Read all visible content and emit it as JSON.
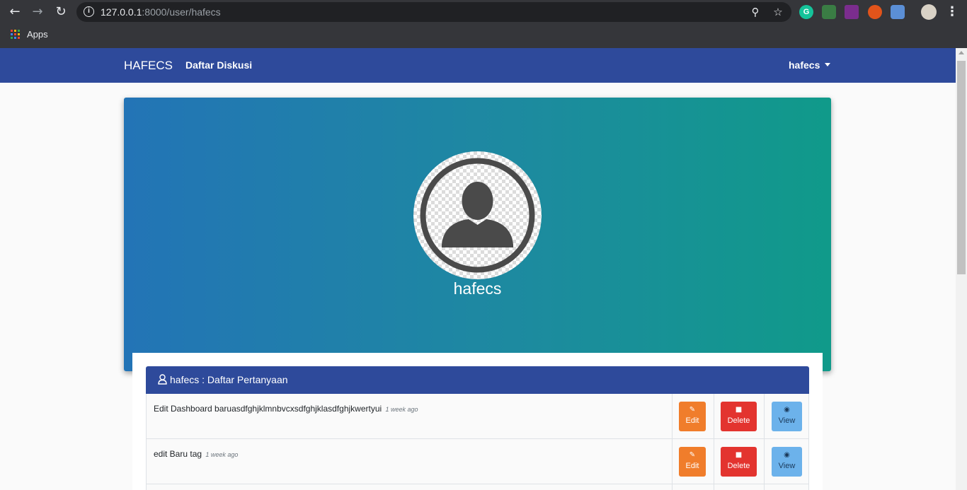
{
  "browser": {
    "url_host": "127.0.0.1",
    "url_rest": ":8000/user/hafecs",
    "bookmark_apps": "Apps",
    "extension_g": "G"
  },
  "nav": {
    "brand": "HAFECS",
    "link": "Daftar Diskusi",
    "user": "hafecs"
  },
  "profile": {
    "name": "hafecs"
  },
  "card": {
    "title": "hafecs : Daftar Pertanyaan"
  },
  "questions": [
    {
      "title": "Edit Dashboard baruasdfghjklmnbvcxsdfghjklasdfghjkwertyui",
      "time": "1 week ago"
    },
    {
      "title": "edit Baru tag",
      "time": "1 week ago"
    }
  ],
  "buttons": {
    "edit": "Edit",
    "delete": "Delete",
    "view": "View"
  },
  "colors": {
    "navbar": "#2e4a9b",
    "hero_start": "#2374b6",
    "hero_end": "#109a8a",
    "edit": "#f07d2b",
    "delete": "#e3342f",
    "view": "#6cb2eb"
  }
}
